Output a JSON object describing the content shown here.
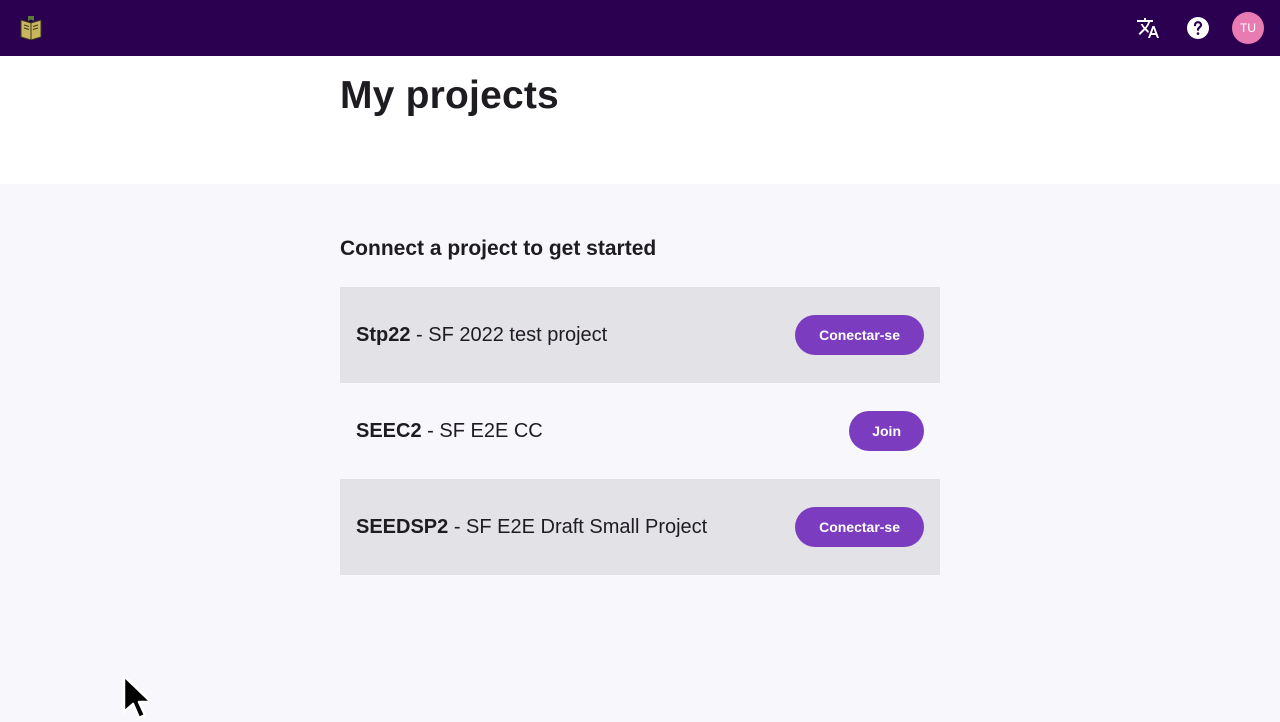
{
  "topbar": {
    "logo_icon": "book-logo-icon",
    "translate_icon": "translate-icon",
    "help_icon": "help-icon",
    "avatar_initials": "TU",
    "background_color": "#2c0050",
    "avatar_color": "#e87bb1"
  },
  "page": {
    "title": "My projects"
  },
  "section": {
    "title": "Connect a project to get started"
  },
  "projects": [
    {
      "code": "Stp22",
      "separator": " - ",
      "name": "SF 2022 test project",
      "action": "Conectar-se"
    },
    {
      "code": "SEEC2",
      "separator": " - ",
      "name": "SF E2E CC",
      "action": "Join"
    },
    {
      "code": "SEEDSP2",
      "separator": " - ",
      "name": "SF E2E Draft Small Project",
      "action": "Conectar-se"
    }
  ],
  "colors": {
    "button": "#7b3cc0",
    "row_shade": "#e3e2e7",
    "content_bg": "#f8f7fc"
  }
}
